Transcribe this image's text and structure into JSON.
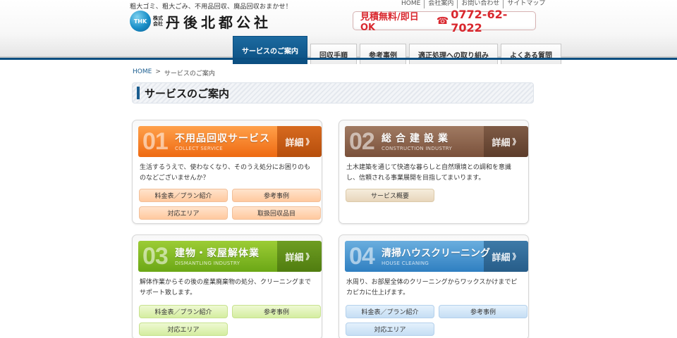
{
  "header": {
    "tagline": "粗大ゴミ、粗大ごみ、不用品回収、廃品回収おまかせ！",
    "utility_nav": [
      "HOME",
      "会社案内",
      "お問い合わせ",
      "サイトマップ"
    ],
    "logo": {
      "mark": "THK",
      "kabushiki": "株式会社",
      "name": "丹後北都公社"
    },
    "contact": {
      "free_estimate": "見積無料/即日OK",
      "phone_icon": "phone-icon",
      "phone": "0772-62-7022"
    }
  },
  "nav": {
    "tabs": [
      {
        "label": "サービスのご案内",
        "active": true
      },
      {
        "label": "回収手順",
        "active": false
      },
      {
        "label": "参考事例",
        "active": false
      },
      {
        "label": "適正処理への取り組み",
        "active": false
      },
      {
        "label": "よくある質問",
        "active": false
      }
    ]
  },
  "breadcrumb": {
    "home": "HOME",
    "separator": ">",
    "current": "サービスのご案内"
  },
  "page_title": "サービスのご案内",
  "cards": [
    {
      "number": "01",
      "title": "不用品回収サービス",
      "subtitle": "COLLECT SERVICE",
      "detail": "詳細",
      "color": "#ee6a12",
      "description": "生活するうえで、使わなくなり、そのうえ処分にお困りのものなどございませんか？",
      "buttons": [
        "料金表／プラン紹介",
        "参考事例",
        "対応エリア",
        "取扱回収品目"
      ]
    },
    {
      "number": "02",
      "title": "総合建設業",
      "subtitle": "CONSTRUCTION INDUSTRY",
      "detail": "詳細",
      "color": "#7a513b",
      "description": "土木建築を通じて快適な暮らしと自然環境との調和を意識し、信頼される事業展開を目指してまいります。",
      "buttons": [
        "サービス概要"
      ]
    },
    {
      "number": "03",
      "title": "建物・家屋解体業",
      "subtitle": "DISMANTLING INDUSTRY",
      "detail": "詳細",
      "color": "#6ba716",
      "description": "解体作業からその後の産業廃棄物の処分、クリーニングまでサポート致します。",
      "buttons": [
        "料金表／プラン紹介",
        "参考事例",
        "対応エリア"
      ]
    },
    {
      "number": "04",
      "title": "清掃ハウスクリーニング",
      "subtitle": "HOUSE CLEANING",
      "detail": "詳細",
      "color": "#2f7fc1",
      "description": "水周り、お部屋全体のクリーニングからワックスかけまでピカピカに仕上げます。",
      "buttons": [
        "料金表／プラン紹介",
        "参考事例",
        "対応エリア"
      ]
    }
  ]
}
